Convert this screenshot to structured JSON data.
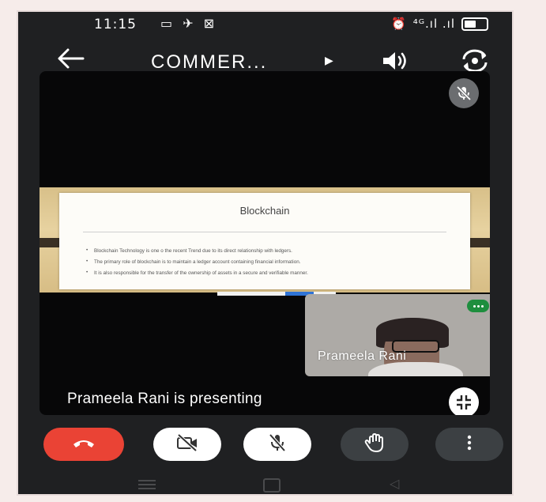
{
  "statusbar": {
    "time": "11:15",
    "left_icons": "▭ ✈ ⊠",
    "network": "⁴ᴳ.ıl .ıl"
  },
  "topbar": {
    "back_icon": "arrow-left-icon",
    "title": "COMMER...",
    "play_glyph": "▶"
  },
  "slide": {
    "title": "Blockchain",
    "bullets": [
      "Blockchain Technology is one o the recent Trend due to its direct relationship with ledgers.",
      "The primary role of blockchain is to maintain a ledger account containing financial information.",
      "It is also responsible for the transfer of the ownership of assets in a secure and verifiable manner."
    ]
  },
  "participant": {
    "name": "Prameela Rani"
  },
  "presenting_text": "Prameela Rani is presenting",
  "colors": {
    "end_call": "#ea4335",
    "speaking": "#1e8e3e",
    "background": "#1f2022"
  },
  "icons": {
    "end_call": "phone-hangup-icon",
    "camera": "camera-off-icon",
    "mic": "mic-off-icon",
    "hand": "raise-hand-icon",
    "more": "more-vert-icon"
  }
}
